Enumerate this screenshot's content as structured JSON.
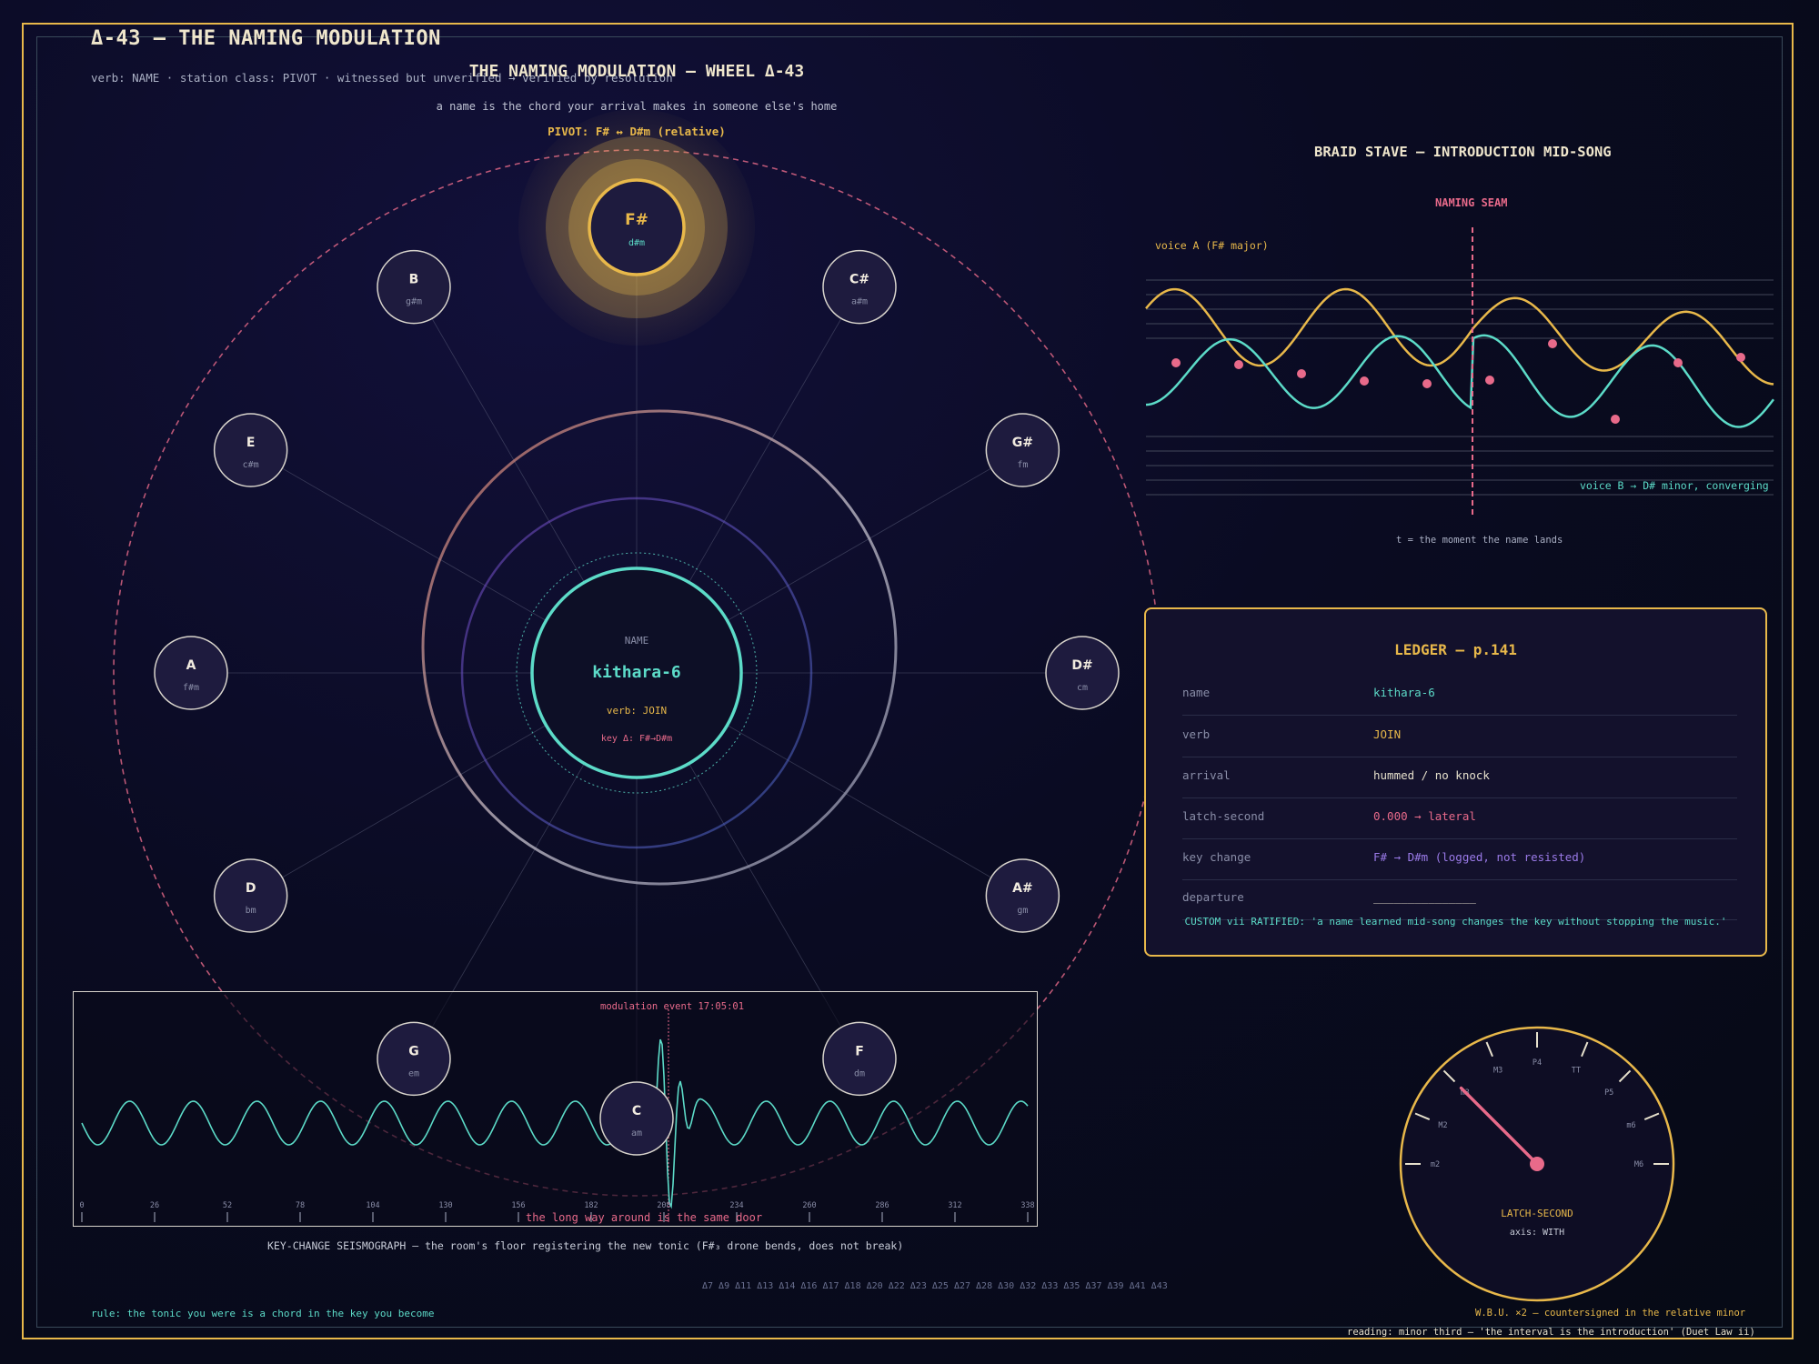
{
  "header": {
    "title": "Δ-43 — THE NAMING MODULATION",
    "subtitle": "verb: NAME  ·  station class: PIVOT  ·  witnessed but unverified → verified by resolution"
  },
  "wheel": {
    "title": "THE NAMING MODULATION — WHEEL Δ-43",
    "tagline": "a name is the chord your arrival makes in someone else's home",
    "pivot_label": "PIVOT: F# ↔ D#m  (relative)",
    "nodes": [
      {
        "name": "F#",
        "relative": "d#m",
        "highlight": true
      },
      {
        "name": "C#",
        "relative": "a#m"
      },
      {
        "name": "G#",
        "relative": "fm"
      },
      {
        "name": "D#",
        "relative": "cm"
      },
      {
        "name": "A#",
        "relative": "gm"
      },
      {
        "name": "F",
        "relative": "dm"
      },
      {
        "name": "C",
        "relative": "am"
      },
      {
        "name": "G",
        "relative": "em"
      },
      {
        "name": "D",
        "relative": "bm"
      },
      {
        "name": "A",
        "relative": "f#m"
      },
      {
        "name": "E",
        "relative": "c#m"
      },
      {
        "name": "B",
        "relative": "g#m"
      }
    ],
    "center": {
      "label": "NAME",
      "name": "kithara-6",
      "verb": "verb: JOIN",
      "key_delta": "key Δ: F#→D#m"
    }
  },
  "braid": {
    "title": "BRAID STAVE — INTRODUCTION MID-SONG",
    "seam_label": "NAMING SEAM",
    "voice_a": "voice A (F# major)",
    "voice_b": "voice B → D# minor, converging",
    "note": "t = the moment the name lands"
  },
  "ledger": {
    "title": "LEDGER — p.141",
    "rows": [
      {
        "key": "name",
        "value": "kithara-6",
        "color": "#5cdbc8"
      },
      {
        "key": "verb",
        "value": "JOIN",
        "color": "#e8b84a"
      },
      {
        "key": "arrival",
        "value": "hummed / no knock",
        "color": "#e6e0cc"
      },
      {
        "key": "latch-second",
        "value": "0.000 → lateral",
        "color": "#e86a8a"
      },
      {
        "key": "key change",
        "value": "F# → D#m  (logged, not resisted)",
        "color": "#9a7ae8"
      },
      {
        "key": "departure",
        "value": "_______________",
        "color": "#e6e0cc"
      }
    ],
    "note": "CUSTOM vii RATIFIED: 'a name learned mid-song changes the key without stopping the music.'"
  },
  "seismograph": {
    "event_label": "modulation event 17:05:01",
    "ticks": [
      "0",
      "26",
      "52",
      "78",
      "104",
      "130",
      "156",
      "182",
      "208",
      "234",
      "260",
      "286",
      "312",
      "338"
    ],
    "footer": "the long way around is the same door",
    "caption": "KEY-CHANGE SEISMOGRAPH — the room's floor registering the new tonic (F#₃ drone bends, does not break)"
  },
  "gauge": {
    "label": "LATCH-SECOND",
    "axis": "axis: WITH",
    "scale": [
      "m2",
      "M2",
      "m3",
      "M3",
      "P4",
      "TT",
      "P5",
      "m6",
      "M6"
    ],
    "needle_at": "m3"
  },
  "footer": {
    "delta_list": "Δ7 Δ9 Δ11 Δ13 Δ14 Δ16 Δ17 Δ18 Δ20 Δ22 Δ23 Δ25 Δ27 Δ28 Δ30 Δ32 Δ33 Δ35 Δ37 Δ39 Δ41 Δ43",
    "rule": "rule: the tonic you were is a chord in the key you become",
    "wbu": "W.B.U. ×2 — countersigned in the relative minor",
    "reading": "reading: minor third — 'the interval is the introduction' (Duet Law ii)"
  },
  "colors": {
    "gold": "#e8b84a",
    "teal": "#5cdbc8",
    "pink": "#e86a8a",
    "violet": "#9a7ae8",
    "frame": "#e8b84a"
  }
}
